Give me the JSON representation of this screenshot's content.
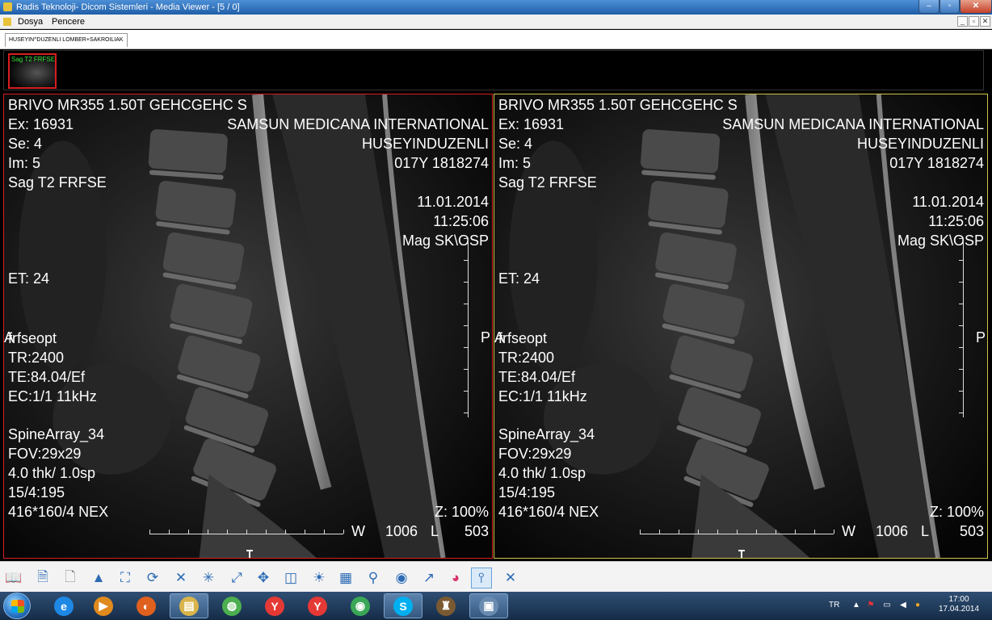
{
  "window": {
    "title": "Radis Teknoloji- Dicom Sistemleri - Media Viewer - [5 / 0]",
    "minimize_glyph": "–",
    "maximize_glyph": "▫",
    "close_glyph": "✕"
  },
  "menu": {
    "items": [
      "Dosya",
      "Pencere"
    ],
    "mdi_buttons": [
      "_",
      "▫",
      "✕"
    ]
  },
  "study_tab": {
    "label": "HUSEYIN^DUZENLI LOMBER+SAKROILIAK"
  },
  "thumbnail": {
    "label": "Sag T2 FRFSE"
  },
  "viewports": [
    {
      "top_left": [
        "BRIVO MR355 1.50T GEHCGEHC  S",
        "Ex: 16931",
        "Se: 4",
        "Im: 5",
        "Sag T2 FRFSE"
      ],
      "top_right": [
        "SAMSUN MEDICANA INTERNATIONAL",
        "HUSEYINDUZENLI",
        "017Y 1818274"
      ],
      "date": "11.01.2014",
      "time": "11:25:06",
      "mag": "Mag SK\\OSP",
      "et": "ET: 24",
      "orient_left": "A",
      "orient_right": "P",
      "params": [
        "frfseopt",
        "TR:2400",
        "TE:84.04/Ef",
        "EC:1/1 11kHz"
      ],
      "coil": [
        "SpineArray_34",
        "FOV:29x29",
        "4.0 thk/ 1.0sp",
        "15/4:195",
        "416*160/4 NEX"
      ],
      "zoom": "Z: 100%",
      "window_w_label": "W",
      "window_w": "1006",
      "window_l_label": "L",
      "window_l": "503"
    },
    {
      "top_left": [
        "BRIVO MR355 1.50T GEHCGEHC  S",
        "Ex: 16931",
        "Se: 4",
        "Im: 5",
        "Sag T2 FRFSE"
      ],
      "top_right": [
        "SAMSUN MEDICANA INTERNATIONAL",
        "HUSEYINDUZENLI",
        "017Y 1818274"
      ],
      "date": "11.01.2014",
      "time": "11:25:06",
      "mag": "Mag SK\\OSP",
      "et": "ET: 24",
      "orient_left": "A",
      "orient_right": "P",
      "params": [
        "frfseopt",
        "TR:2400",
        "TE:84.04/Ef",
        "EC:1/1 11kHz"
      ],
      "coil": [
        "SpineArray_34",
        "FOV:29x29",
        "4.0 thk/ 1.0sp",
        "15/4:195",
        "416*160/4 NEX"
      ],
      "zoom": "Z: 100%",
      "window_w_label": "W",
      "window_w": "1006",
      "window_l_label": "L",
      "window_l": "503"
    }
  ],
  "toolbar": {
    "tools": [
      {
        "icon": "open-book-icon",
        "glyph": "📖",
        "color": "#c98a2e"
      },
      {
        "icon": "document-list-icon",
        "glyph": "🗎",
        "color": "#2d6bb5"
      },
      {
        "icon": "report-icon",
        "glyph": "🗋",
        "color": "#888888"
      },
      {
        "icon": "patient-info-icon",
        "glyph": "▲",
        "color": "#2d6bb5"
      },
      {
        "icon": "image-info-icon",
        "glyph": "⛶",
        "color": "#2d6bb5"
      },
      {
        "icon": "rotate-icon",
        "glyph": "⟳",
        "color": "#2d6bb5"
      },
      {
        "icon": "flip-icon",
        "glyph": "✕",
        "color": "#2d6bb5"
      },
      {
        "icon": "crosshair-icon",
        "glyph": "✳",
        "color": "#2d6bb5"
      },
      {
        "icon": "measure-icon",
        "glyph": "⤢",
        "color": "#2d6bb5"
      },
      {
        "icon": "pan-icon",
        "glyph": "✥",
        "color": "#2d6bb5"
      },
      {
        "icon": "split-view-icon",
        "glyph": "◫",
        "color": "#2d6bb5"
      },
      {
        "icon": "brightness-icon",
        "glyph": "☀",
        "color": "#2d6bb5"
      },
      {
        "icon": "layout-grid-icon",
        "glyph": "▦",
        "color": "#2d6bb5"
      },
      {
        "icon": "zoom-icon",
        "glyph": "⚲",
        "color": "#2d6bb5"
      },
      {
        "icon": "cine-icon",
        "glyph": "◉",
        "color": "#2d6bb5"
      },
      {
        "icon": "arrow-icon",
        "glyph": "↗",
        "color": "#2d6bb5"
      },
      {
        "icon": "color-wheel-icon",
        "glyph": "◕",
        "color": "#d6336c"
      },
      {
        "icon": "window-level-icon",
        "glyph": "⫯",
        "color": "#2d6bb5"
      },
      {
        "icon": "close-viewer-icon",
        "glyph": "✕",
        "color": "#2d6bb5"
      }
    ]
  },
  "taskbar": {
    "apps": [
      {
        "icon": "internet-explorer-icon",
        "glyph": "e",
        "color": "#1e88e5"
      },
      {
        "icon": "media-player-icon",
        "glyph": "▶",
        "color": "#e08a1e"
      },
      {
        "icon": "firefox-icon",
        "glyph": "◐",
        "color": "#e0601e"
      },
      {
        "icon": "file-explorer-icon",
        "glyph": "▤",
        "color": "#d9b44a"
      },
      {
        "icon": "network-icon",
        "glyph": "◍",
        "color": "#4caf50"
      },
      {
        "icon": "yandex-icon",
        "glyph": "Y",
        "color": "#e53935"
      },
      {
        "icon": "yandex-browser-icon",
        "glyph": "Y",
        "color": "#e53935"
      },
      {
        "icon": "chrome-icon",
        "glyph": "◉",
        "color": "#3aa757"
      },
      {
        "icon": "skype-icon",
        "glyph": "S",
        "color": "#00aff0"
      },
      {
        "icon": "game-icon",
        "glyph": "♜",
        "color": "#7a5a32"
      },
      {
        "icon": "dicom-viewer-icon",
        "glyph": "▣",
        "color": "#6a8bb0"
      }
    ],
    "tray": {
      "lang": "TR",
      "time": "17:00",
      "date": "17.04.2014"
    }
  }
}
